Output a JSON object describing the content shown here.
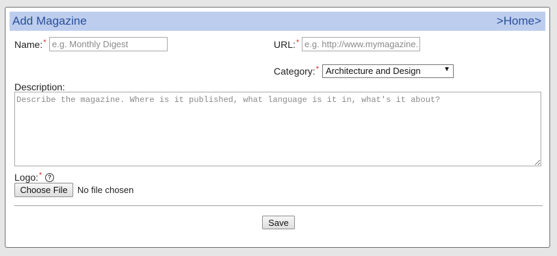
{
  "header": {
    "title": "Add Magazine",
    "home_link": ">Home>"
  },
  "form": {
    "name": {
      "label": "Name:",
      "required_mark": "*",
      "value": "",
      "placeholder": "e.g. Monthly Digest"
    },
    "url": {
      "label": "URL:",
      "required_mark": "*",
      "value": "",
      "placeholder": "e.g. http://www.mymagazine.com"
    },
    "category": {
      "label": "Category:",
      "required_mark": "*",
      "selected": "Architecture and Design",
      "arrow_icon": "triangle-down-icon"
    },
    "description": {
      "label": "Description:",
      "value": "",
      "placeholder": "Describe the magazine. Where is it published, what language is it in, what's it about?"
    },
    "logo": {
      "label": "Logo:",
      "required_mark": "*",
      "help_glyph": "?",
      "choose_button": "Choose File",
      "file_status": "No file chosen"
    },
    "save_button": "Save"
  },
  "colors": {
    "header_bg": "#bdcdee",
    "header_text": "#2b4f9a",
    "required": "#e02020"
  }
}
